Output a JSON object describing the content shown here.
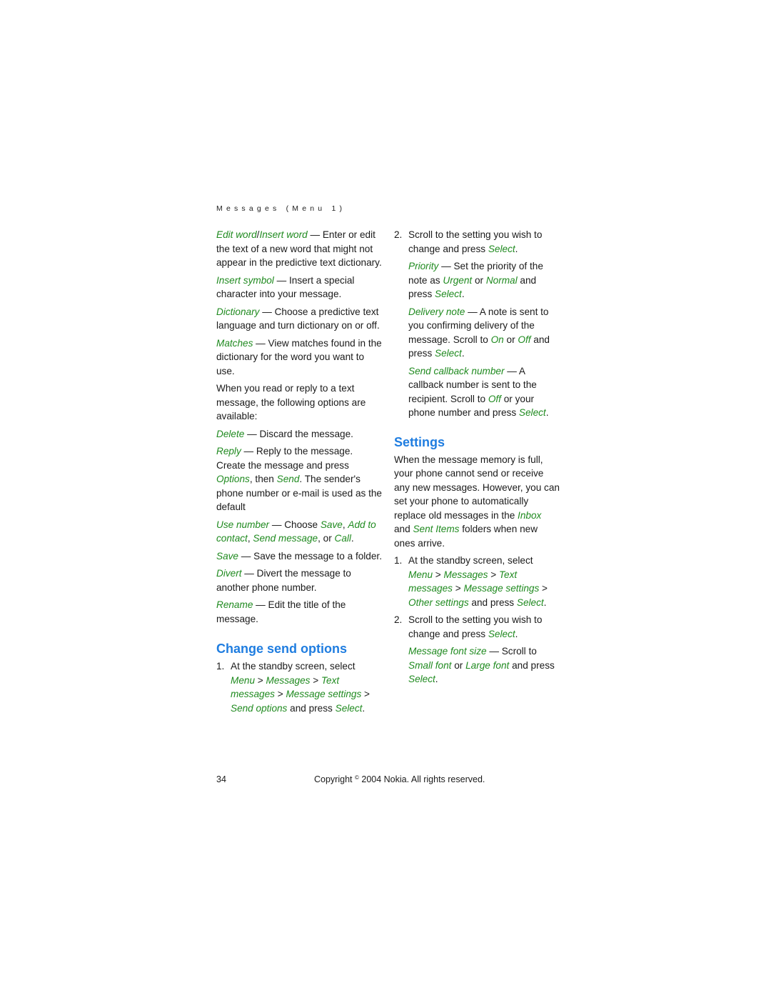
{
  "running_head": "Messages (Menu 1)",
  "colors": {
    "link_green": "#1f8a1f",
    "heading_blue": "#1f7de0",
    "text": "#1a1a1a"
  },
  "left": {
    "edit_word": {
      "term1": "Edit word",
      "sep": "/",
      "term2": "Insert word",
      "desc": " — Enter or edit the text of a new word that might not appear in the predictive text dictionary."
    },
    "insert_symbol": {
      "term": "Insert symbol",
      "desc": " — Insert a special character into your message."
    },
    "dictionary": {
      "term": "Dictionary",
      "desc": " — Choose a predictive text language and turn dictionary on or off."
    },
    "matches": {
      "term": "Matches",
      "desc": " — View matches found in the dictionary for the word you want to use."
    },
    "intro": "When you read or reply to a text message, the following options are available:",
    "delete": {
      "term": "Delete",
      "desc": " — Discard the message."
    },
    "reply": {
      "term": "Reply",
      "desc1": " — Reply to the message. Create the message and press ",
      "options": "Options",
      "desc2": ", then ",
      "send": "Send",
      "desc3": ". The sender's phone number or e-mail is used as the default"
    },
    "use_number": {
      "term": "Use number",
      "desc1": " — Choose ",
      "save": "Save",
      "c1": ", ",
      "add": "Add to contact",
      "c2": ", ",
      "send_msg": "Send message",
      "c3": ", or ",
      "call": "Call",
      "end": "."
    },
    "save": {
      "term": "Save",
      "desc": " — Save the message to a folder."
    },
    "divert": {
      "term": "Divert",
      "desc": " — Divert the message to another phone number."
    },
    "rename": {
      "term": "Rename",
      "desc": " — Edit the title of the message."
    },
    "heading": "Change send options",
    "step1": {
      "num": "1.",
      "text": "At the standby screen, select ",
      "m1": "Menu",
      "gt1": " > ",
      "m2": "Messages",
      "gt2": " > ",
      "m3": "Text messages",
      "gt3": " > ",
      "m4": "Message settings",
      "gt4": " > ",
      "m5": "Send options",
      "and": " and press ",
      "sel": "Select",
      "end": "."
    }
  },
  "right": {
    "step2": {
      "num": "2.",
      "text": "Scroll to the setting you wish to change and press ",
      "sel": "Select",
      "end": "."
    },
    "priority": {
      "term": "Priority",
      "d1": " — Set the priority of the note as ",
      "urgent": "Urgent",
      "or": " or ",
      "normal": "Normal",
      "d2": " and press ",
      "sel": "Select",
      "end": "."
    },
    "delivery": {
      "term": "Delivery note",
      "d1": " — A note is sent to you confirming delivery of the message. Scroll to ",
      "on": "On",
      "or": " or ",
      "off": "Off",
      "d2": " and press ",
      "sel": "Select",
      "end": "."
    },
    "callback": {
      "term": "Send callback number",
      "d1": " — A callback number is sent to the recipient. Scroll to ",
      "off": "Off",
      "d2": " or your phone number and press ",
      "sel": "Select",
      "end": "."
    },
    "heading": "Settings",
    "intro": {
      "t1": "When the message memory is full, your phone cannot send or receive any new messages. However, you can set your phone to automatically replace old messages in the ",
      "inbox": "Inbox",
      "t2": " and ",
      "sent": "Sent Items",
      "t3": " folders when new ones arrive."
    },
    "step1": {
      "num": "1.",
      "text": "At the standby screen, select ",
      "m1": "Menu",
      "gt1": " > ",
      "m2": "Messages",
      "gt2": " > ",
      "m3": "Text messages",
      "gt3": " > ",
      "m4": "Message settings",
      "gt4": " > ",
      "m5": "Other settings",
      "and": " and press ",
      "sel": "Select",
      "end": "."
    },
    "font_size": {
      "term": "Message font size",
      "d1": " — Scroll to ",
      "small": "Small font",
      "or": " or ",
      "large": "Large font",
      "d2": " and press ",
      "sel": "Select",
      "end": "."
    }
  },
  "footer": {
    "page_number": "34",
    "copyright_pre": "Copyright ",
    "copyright_symbol": "©",
    "copyright_post": " 2004 Nokia. All rights reserved."
  }
}
